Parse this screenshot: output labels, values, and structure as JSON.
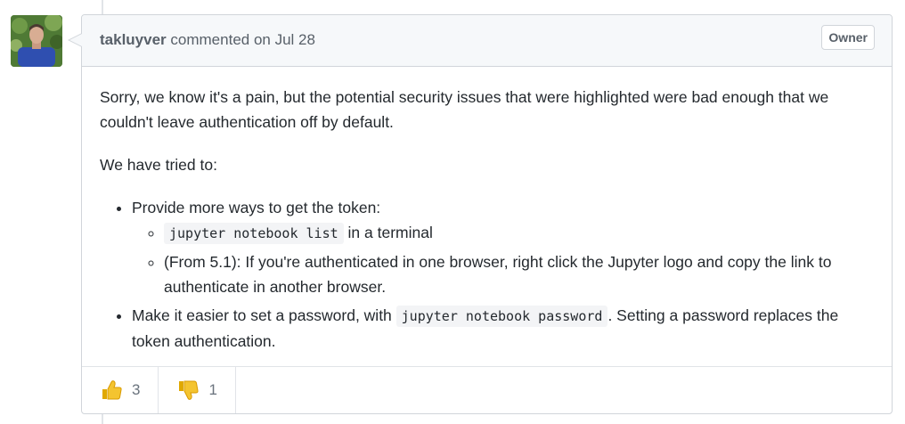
{
  "comment": {
    "author": "takluyver",
    "action": "commented on",
    "date": "Jul 28",
    "badge": "Owner",
    "body": {
      "paragraph1": "Sorry, we know it's a pain, but the potential security issues that were highlighted were bad enough that we couldn't leave authentication off by default.",
      "paragraph2": "We have tried to:",
      "bullet1": {
        "text": "Provide more ways to get the token:",
        "sub1_code": "jupyter notebook list",
        "sub1_text": " in a terminal",
        "sub2_text": "(From 5.1): If you're authenticated in one browser, right click the Jupyter logo and copy the link to authenticate in another browser."
      },
      "bullet2": {
        "text_before": "Make it easier to set a password, with ",
        "code": "jupyter notebook password",
        "text_after": ". Setting a password replaces the token authentication."
      }
    },
    "reactions": [
      {
        "icon": "thumbs-up-icon",
        "count": "3"
      },
      {
        "icon": "thumbs-down-icon",
        "count": "1"
      }
    ]
  },
  "colors": {
    "header_bg": "#f6f8fa",
    "border": "#d1d5da",
    "text": "#24292e",
    "muted": "#586069",
    "emoji_yellow": "#f4b400"
  }
}
